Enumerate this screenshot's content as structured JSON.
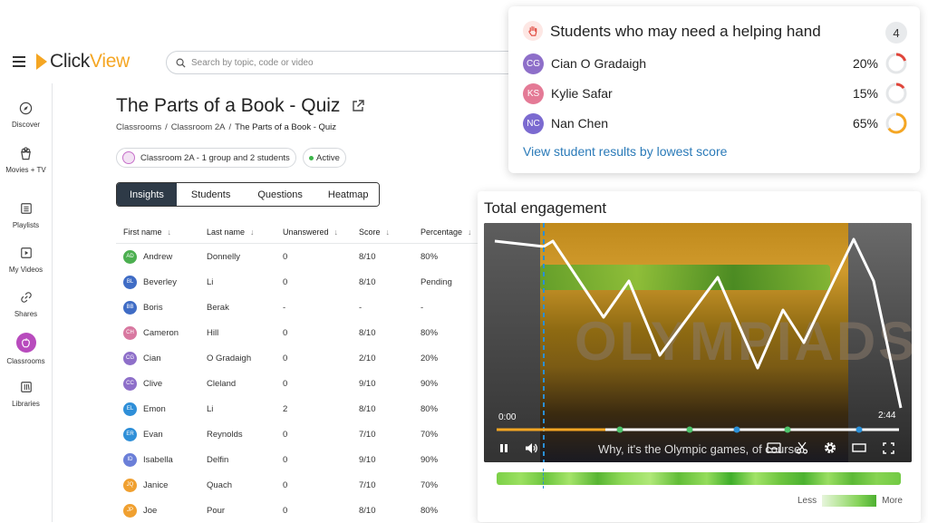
{
  "header": {
    "logo_text": "ClickView",
    "search_placeholder": "Search by topic, code or video"
  },
  "sidebar": {
    "items": [
      {
        "label": "Discover",
        "icon": "compass-icon"
      },
      {
        "label": "Movies + TV",
        "icon": "popcorn-icon"
      },
      {
        "label": "Playlists",
        "icon": "playlist-icon"
      },
      {
        "label": "My Videos",
        "icon": "video-icon"
      },
      {
        "label": "Shares",
        "icon": "link-icon"
      },
      {
        "label": "Classrooms",
        "icon": "apple-icon"
      },
      {
        "label": "Libraries",
        "icon": "library-icon"
      }
    ],
    "active": "Classrooms"
  },
  "page": {
    "title": "The Parts of a Book - Quiz",
    "breadcrumb": [
      "Classrooms",
      "Classroom 2A",
      "The Parts of a Book - Quiz"
    ],
    "class_chip": "Classroom 2A - 1 group and 2 students",
    "status_chip": "Active"
  },
  "tabs": [
    "Insights",
    "Students",
    "Questions",
    "Heatmap"
  ],
  "active_tab": "Insights",
  "table": {
    "headers": [
      "First name",
      "Last name",
      "Unanswered",
      "Score",
      "Percentage"
    ],
    "rows": [
      {
        "initials": "AD",
        "color": "#4caf50",
        "first": "Andrew",
        "last": "Donnelly",
        "unanswered": "0",
        "score": "8/10",
        "pct": "80%"
      },
      {
        "initials": "BL",
        "color": "#3f6cc5",
        "first": "Beverley",
        "last": "Li",
        "unanswered": "0",
        "score": "8/10",
        "pct": "Pending"
      },
      {
        "initials": "BB",
        "color": "#3f6cc5",
        "first": "Boris",
        "last": "Berak",
        "unanswered": "-",
        "score": "-",
        "pct": "-"
      },
      {
        "initials": "CH",
        "color": "#d878a0",
        "first": "Cameron",
        "last": "Hill",
        "unanswered": "0",
        "score": "8/10",
        "pct": "80%"
      },
      {
        "initials": "CG",
        "color": "#8e6fc9",
        "first": "Cian",
        "last": "O Gradaigh",
        "unanswered": "0",
        "score": "2/10",
        "pct": "20%"
      },
      {
        "initials": "CC",
        "color": "#8e6fc9",
        "first": "Clive",
        "last": "Cleland",
        "unanswered": "0",
        "score": "9/10",
        "pct": "90%"
      },
      {
        "initials": "EL",
        "color": "#2f8fd8",
        "first": "Emon",
        "last": "Li",
        "unanswered": "2",
        "score": "8/10",
        "pct": "80%"
      },
      {
        "initials": "ER",
        "color": "#2f8fd8",
        "first": "Evan",
        "last": "Reynolds",
        "unanswered": "0",
        "score": "7/10",
        "pct": "70%"
      },
      {
        "initials": "ID",
        "color": "#6b7fd8",
        "first": "Isabella",
        "last": "Delfin",
        "unanswered": "0",
        "score": "9/10",
        "pct": "90%"
      },
      {
        "initials": "JQ",
        "color": "#f0a030",
        "first": "Janice",
        "last": "Quach",
        "unanswered": "0",
        "score": "7/10",
        "pct": "70%"
      },
      {
        "initials": "JP",
        "color": "#f0a030",
        "first": "Joe",
        "last": "Pour",
        "unanswered": "0",
        "score": "8/10",
        "pct": "80%"
      }
    ]
  },
  "helping_hand": {
    "title": "Students who may need a helping hand",
    "count": "4",
    "students": [
      {
        "initials": "CG",
        "color": "#8e6fc9",
        "name": "Cian O Gradaigh",
        "pct": "20%",
        "value": 0.2,
        "ring_color": "#e0453a"
      },
      {
        "initials": "KS",
        "color": "#e47a96",
        "name": "Kylie Safar",
        "pct": "15%",
        "value": 0.15,
        "ring_color": "#e0453a"
      },
      {
        "initials": "NC",
        "color": "#7b6ad0",
        "name": "Nan Chen",
        "pct": "65%",
        "value": 0.65,
        "ring_color": "#f5a623"
      }
    ],
    "link": "View student results by lowest score"
  },
  "engagement": {
    "title": "Total engagement",
    "time_start": "0:00",
    "time_end": "2:44",
    "video_text": "OLYMPIADS",
    "caption": "Why, it's the Olympic games, of course.",
    "legend_less": "Less",
    "legend_more": "More"
  }
}
